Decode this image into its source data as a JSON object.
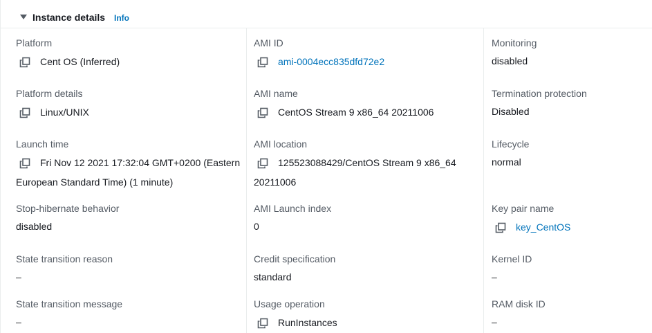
{
  "header": {
    "title": "Instance details",
    "info": "Info"
  },
  "col1": {
    "platform": {
      "label": "Platform",
      "value": "Cent OS (Inferred)"
    },
    "platform_details": {
      "label": "Platform details",
      "value": "Linux/UNIX"
    },
    "launch_time": {
      "label": "Launch time",
      "value_line1": "Fri Nov 12 2021 17:32:04 GMT+0200 (Eastern",
      "value_line2": "European Standard Time) (1 minute)"
    },
    "stop_hibernate": {
      "label": "Stop-hibernate behavior",
      "value": "disabled"
    },
    "state_reason": {
      "label": "State transition reason",
      "value": "–"
    },
    "state_message": {
      "label": "State transition message",
      "value": "–"
    }
  },
  "col2": {
    "ami_id": {
      "label": "AMI ID",
      "value": "ami-0004ecc835dfd72e2"
    },
    "ami_name": {
      "label": "AMI name",
      "value": "CentOS Stream 9 x86_64 20211006"
    },
    "ami_location": {
      "label": "AMI location",
      "value_line1": "125523088429/CentOS Stream 9 x86_64",
      "value_line2": "20211006"
    },
    "ami_launch_index": {
      "label": "AMI Launch index",
      "value": "0"
    },
    "credit_spec": {
      "label": "Credit specification",
      "value": "standard"
    },
    "usage_operation": {
      "label": "Usage operation",
      "value": "RunInstances"
    }
  },
  "col3": {
    "monitoring": {
      "label": "Monitoring",
      "value": "disabled"
    },
    "termination": {
      "label": "Termination protection",
      "value": "Disabled"
    },
    "lifecycle": {
      "label": "Lifecycle",
      "value": "normal"
    },
    "key_pair": {
      "label": "Key pair name",
      "value": "key_CentOS"
    },
    "kernel_id": {
      "label": "Kernel ID",
      "value": "–"
    },
    "ram_disk_id": {
      "label": "RAM disk ID",
      "value": "–"
    }
  },
  "colors": {
    "link": "#0073bb",
    "label": "#545b64",
    "text": "#16191f",
    "divider": "#eaeded"
  },
  "icons": [
    "caret-down-icon",
    "copy-icon"
  ]
}
